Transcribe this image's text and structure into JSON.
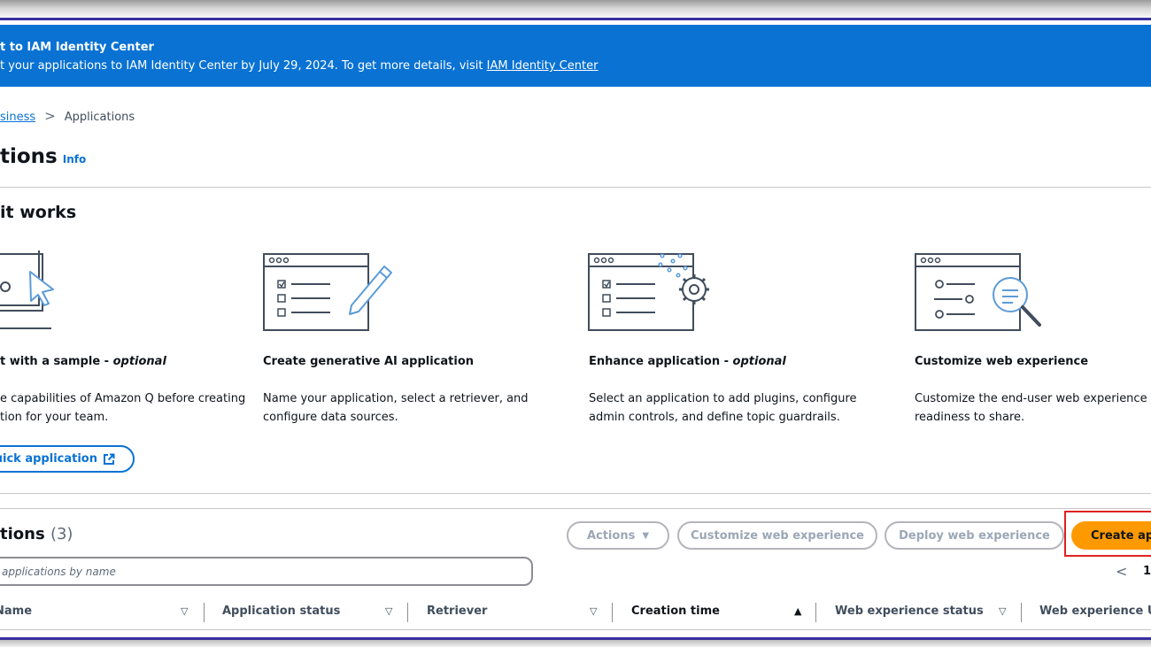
{
  "banner": {
    "title": "t to IAM Identity Center",
    "text": "t your applications to IAM Identity Center by July 29, 2024. To get more details, visit ",
    "link_label": "IAM Identity Center"
  },
  "breadcrumb": {
    "parent": "siness",
    "separator": ">",
    "current": "Applications"
  },
  "page": {
    "title": "tions",
    "info": "Info"
  },
  "how_it_works": {
    "title": "it works",
    "steps": [
      {
        "icon": "laptop-cursor-icon",
        "title": "t with a sample - ",
        "optional": "optional",
        "desc_line1": "e capabilities of Amazon Q before creating",
        "desc_line2": "tion for your team."
      },
      {
        "icon": "checklist-pencil-icon",
        "title": "Create generative AI application",
        "optional": "",
        "desc_line1": "Name your application, select a retriever, and",
        "desc_line2": "configure data sources."
      },
      {
        "icon": "checklist-gear-icon",
        "title": "Enhance application - ",
        "optional": "optional",
        "desc_line1": "Select an application to add plugins, configure",
        "desc_line2": "admin controls, and define topic guardrails."
      },
      {
        "icon": "search-magnifier-icon",
        "title": "Customize web experience",
        "optional": "",
        "desc_line1": "Customize the end-user web experience",
        "desc_line2": "readiness to share."
      }
    ],
    "quick_button": "uick application",
    "quick_button_icon": "external-link-icon"
  },
  "applications": {
    "title": "tions",
    "count": "(3)",
    "actions_label": "Actions",
    "customize_label": "Customize web experience",
    "deploy_label": "Deploy web experience",
    "create_label": "Create ap",
    "search_placeholder": "applications by name",
    "pagination": {
      "prev_icon": "chevron-left-icon",
      "page": "1"
    },
    "columns": [
      "Name",
      "Application status",
      "Retriever",
      "Creation time",
      "Web experience status",
      "Web experience UI"
    ]
  },
  "colors": {
    "banner": "#0972d3",
    "primary_button": "#ff9900",
    "highlight": "#e0211f",
    "link": "#0972d3"
  }
}
